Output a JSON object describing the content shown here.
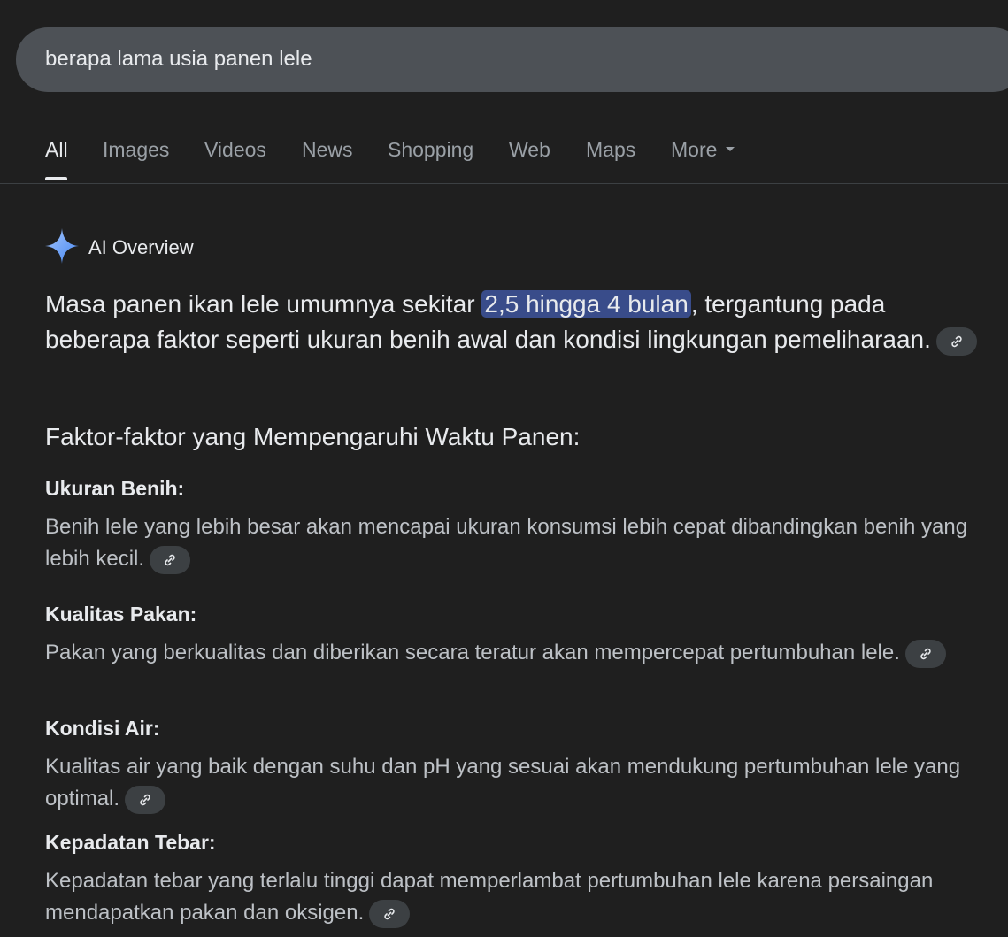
{
  "search": {
    "query": "berapa lama usia panen lele"
  },
  "tabs": {
    "all": "All",
    "images": "Images",
    "videos": "Videos",
    "news": "News",
    "shopping": "Shopping",
    "web": "Web",
    "maps": "Maps",
    "more": "More"
  },
  "ai_overview": {
    "title": "AI Overview",
    "icon": "sparkle-icon",
    "accent_color": "#8ab4f8",
    "summary_before": "Masa panen ikan lele umumnya sekitar ",
    "summary_highlight": "2,5 hingga 4 bulan",
    "summary_after": ", tergantung pada beberapa faktor seperti ukuran benih awal dan kondisi lingkungan pemeliharaan.",
    "section_title": "Faktor-faktor yang Mempengaruhi Waktu Panen:",
    "factors": [
      {
        "title": "Ukuran Benih:",
        "desc": "Benih lele yang lebih besar akan mencapai ukuran konsumsi lebih cepat dibandingkan benih yang lebih kecil."
      },
      {
        "title": "Kualitas Pakan:",
        "desc": "Pakan yang berkualitas dan diberikan secara teratur akan mempercepat pertumbuhan lele."
      },
      {
        "title": "Kondisi Air:",
        "desc": "Kualitas air yang baik dengan suhu dan pH yang sesuai akan mendukung pertumbuhan lele yang optimal."
      },
      {
        "title": "Kepadatan Tebar:",
        "desc": "Kepadatan tebar yang terlalu tinggi dapat memperlambat pertumbuhan lele karena persaingan mendapatkan pakan dan oksigen."
      }
    ]
  },
  "colors": {
    "background": "#1f1f1f",
    "searchbar": "#4d5156",
    "highlight": "#394c8a",
    "chip": "#3c4043"
  }
}
